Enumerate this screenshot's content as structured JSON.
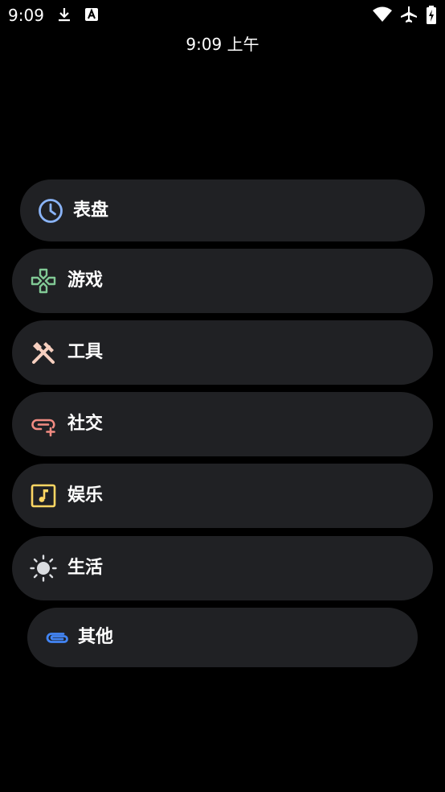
{
  "status_bar": {
    "time": "9:09",
    "icons": [
      "download-icon",
      "text-a-icon",
      "wifi-icon",
      "airplane-icon",
      "battery-icon"
    ]
  },
  "clock": {
    "text": "9:09 上午"
  },
  "menu": {
    "items": [
      {
        "label": "表盘",
        "icon": "clock-icon",
        "color": "#8ab4f8"
      },
      {
        "label": "游戏",
        "icon": "gamepad-icon",
        "color": "#81c995"
      },
      {
        "label": "工具",
        "icon": "tools-icon",
        "color": "#f6cfbf"
      },
      {
        "label": "社交",
        "icon": "chat-link-icon",
        "color": "#f28b82"
      },
      {
        "label": "娱乐",
        "icon": "music-note-icon",
        "color": "#fdd663"
      },
      {
        "label": "生活",
        "icon": "sun-icon",
        "color": "#dadce0"
      },
      {
        "label": "其他",
        "icon": "paperclip-icon",
        "color": "#4285f4"
      }
    ]
  },
  "colors": {
    "background": "#000000",
    "item_background": "#202124",
    "text": "#ffffff"
  }
}
